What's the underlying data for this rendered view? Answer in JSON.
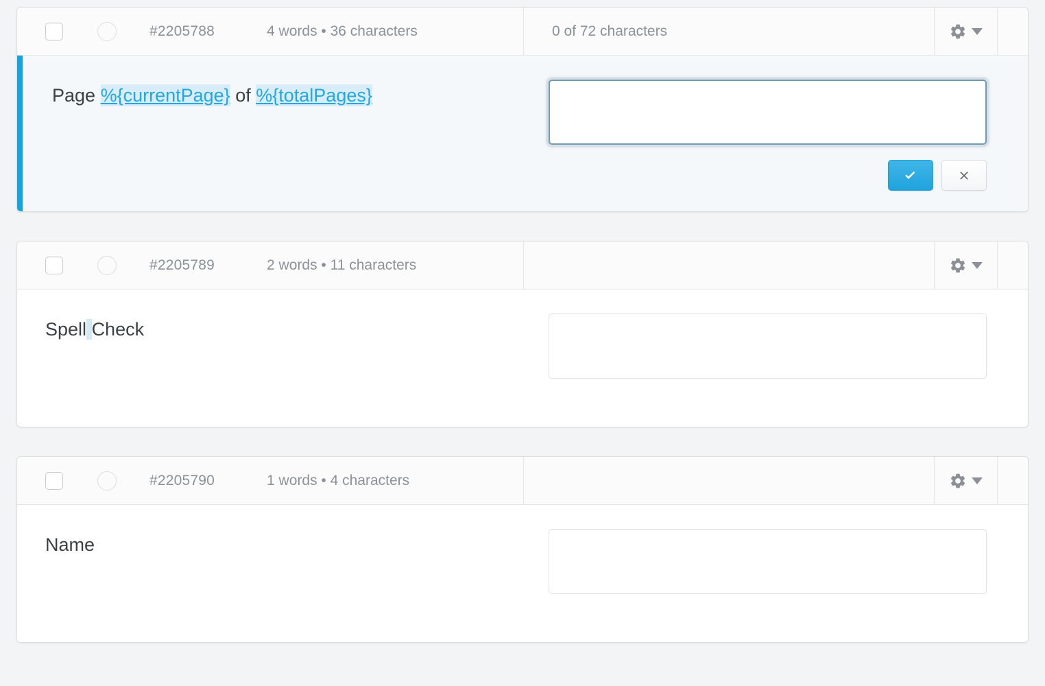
{
  "colors": {
    "accent_blue": "#12a3e0",
    "placeholder_text": "#24a7e0",
    "placeholder_highlight": "#d9edf9",
    "active_row_background": "#f4f8fb",
    "page_background": "#f2f4f5",
    "muted_text": "#8b9196",
    "body_text": "#3c4043",
    "confirm_button": "#20a3dd"
  },
  "icons": {
    "gear": "gear-icon",
    "caret_down": "chevron-down-icon",
    "confirm": "check-icon",
    "cancel": "close-icon",
    "checkbox": "checkbox-icon",
    "radio": "radio-icon"
  },
  "segments": [
    {
      "id_label": "#2205788",
      "word_count_label": "4 words • 36 characters",
      "char_count_label": "0 of 72 characters",
      "active": true,
      "source": {
        "parts": [
          {
            "text": "Page ",
            "type": "plain"
          },
          {
            "text": "%{currentPage}",
            "type": "placeholder"
          },
          {
            "text": " of ",
            "type": "plain"
          },
          {
            "text": "%{totalPages}",
            "type": "placeholder"
          }
        ],
        "plain_text": "Page %{currentPage} of %{totalPages}"
      },
      "target_value": "",
      "target_placeholder": "",
      "focused": true,
      "show_actions": true,
      "confirm_label": "",
      "cancel_label": ""
    },
    {
      "id_label": "#2205789",
      "word_count_label": "2 words • 11 characters",
      "char_count_label": "",
      "active": false,
      "source": {
        "parts": [
          {
            "text": "Spell",
            "type": "plain"
          },
          {
            "text": " ",
            "type": "space-highlight"
          },
          {
            "text": "Check",
            "type": "plain"
          }
        ],
        "plain_text": "Spell Check"
      },
      "target_value": "",
      "target_placeholder": "",
      "focused": false,
      "show_actions": false,
      "confirm_label": "",
      "cancel_label": ""
    },
    {
      "id_label": "#2205790",
      "word_count_label": "1 words • 4 characters",
      "char_count_label": "",
      "active": false,
      "source": {
        "parts": [
          {
            "text": "Name",
            "type": "plain"
          }
        ],
        "plain_text": "Name"
      },
      "target_value": "",
      "target_placeholder": "",
      "focused": false,
      "show_actions": false,
      "confirm_label": "",
      "cancel_label": ""
    }
  ]
}
